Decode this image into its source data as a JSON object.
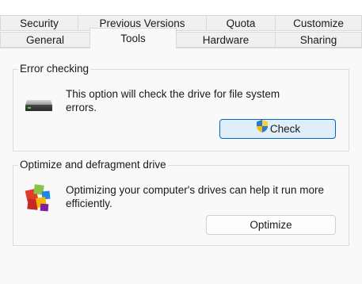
{
  "tabs_back_row": [
    {
      "label": "Security"
    },
    {
      "label": "Previous Versions"
    },
    {
      "label": "Quota"
    },
    {
      "label": "Customize"
    }
  ],
  "tabs_front_row": [
    {
      "label": "General"
    },
    {
      "label": "Tools",
      "selected": true
    },
    {
      "label": "Hardware"
    },
    {
      "label": "Sharing"
    }
  ],
  "error_checking": {
    "title": "Error checking",
    "description": "This option will check the drive for file system errors.",
    "button_label": "Check",
    "icon": "drive-icon",
    "button_icon": "uac-shield-icon"
  },
  "optimize": {
    "title": "Optimize and defragment drive",
    "description": "Optimizing your computer's drives can help it run more efficiently.",
    "button_label": "Optimize",
    "icon": "defragment-icon"
  },
  "colors": {
    "accent": "#0067c0",
    "accent_fill": "#e0eef9",
    "panel_bg": "#f9f9f9"
  }
}
